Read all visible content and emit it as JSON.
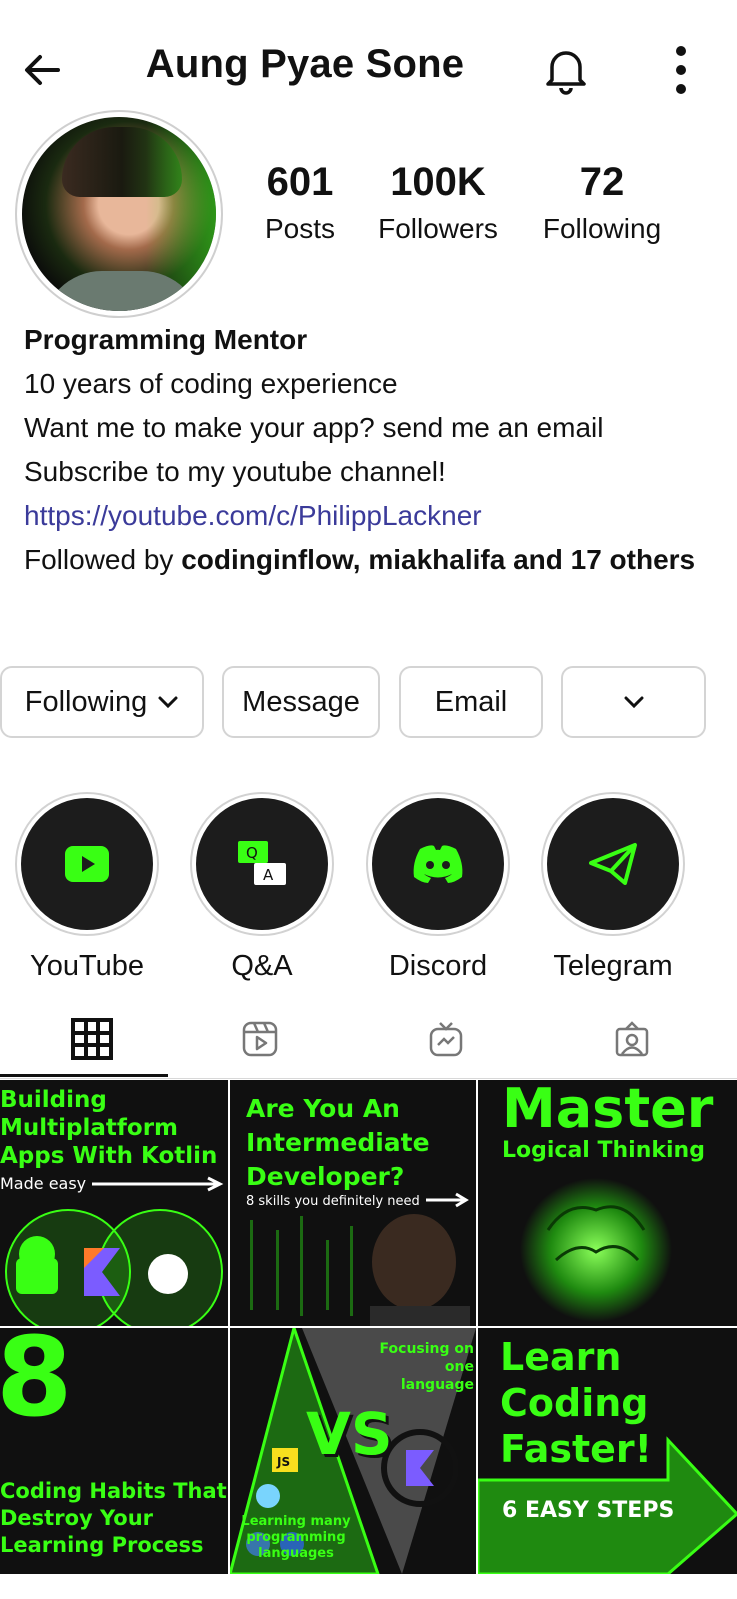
{
  "header": {
    "title": "Aung Pyae Sone",
    "back_icon": "arrow-left-icon",
    "bell_icon": "bell-icon",
    "more_icon": "more-vertical-icon"
  },
  "stats": {
    "posts": {
      "value": "601",
      "label": "Posts"
    },
    "followers": {
      "value": "100K",
      "label": "Followers"
    },
    "following": {
      "value": "72",
      "label": "Following"
    }
  },
  "bio": {
    "name": "Programming Mentor",
    "line1": "10 years of coding experience",
    "line2": "Want me to make your app? send me an email",
    "line3": "Subscribe to my youtube channel!",
    "link": "https://youtube.com/c/PhilippLackner",
    "followed_prefix": "Followed by ",
    "followed_names": "codinginflow, miakhalifa and 17 others"
  },
  "actions": {
    "following": "Following",
    "message": "Message",
    "email": "Email"
  },
  "highlights": [
    {
      "label": "YouTube",
      "icon": "youtube-icon"
    },
    {
      "label": "Q&A",
      "icon": "qa-icon"
    },
    {
      "label": "Discord",
      "icon": "discord-icon"
    },
    {
      "label": "Telegram",
      "icon": "telegram-icon"
    }
  ],
  "tabs": [
    "grid-icon",
    "reels-icon",
    "igtv-icon",
    "tagged-icon"
  ],
  "posts": [
    {
      "title": "Building Multiplatform Apps With Kotlin",
      "sub": "Made easy"
    },
    {
      "title": "Are You An Intermediate Developer?",
      "sub": "8 skills you definitely need"
    },
    {
      "title": "Master",
      "sub": "Logical Thinking"
    },
    {
      "title": "8",
      "sub": "Coding Habits That Destroy Your Learning Process"
    },
    {
      "title": "VS",
      "sub": "Focusing on one language",
      "sub2": "Learning many programming languages"
    },
    {
      "title": "Learn Coding Faster!",
      "sub": "6 EASY STEPS"
    }
  ],
  "colors": {
    "accent": "#39ff14",
    "link": "#3b3b9a",
    "tile_bg": "#101010"
  }
}
